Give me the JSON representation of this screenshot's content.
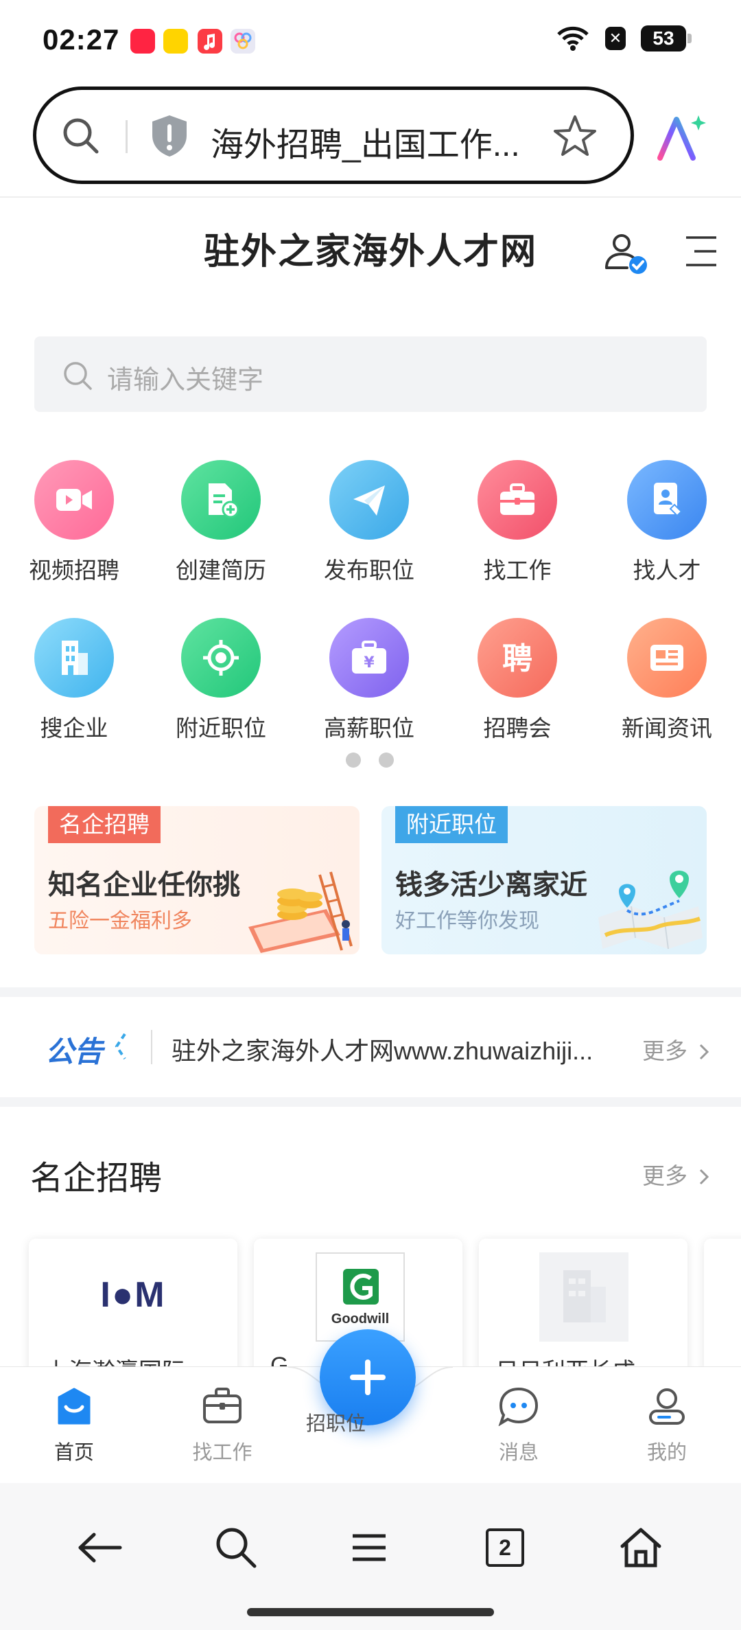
{
  "status_bar": {
    "time": "02:27",
    "battery": "53",
    "notif_apps": [
      {
        "name": "xiaohongshu-app-icon",
        "color": "#ff2442"
      },
      {
        "name": "yellow-app-icon",
        "color": "#ffd400"
      },
      {
        "name": "music-app-icon",
        "color": "#fc3c44"
      },
      {
        "name": "colorful-app-icon",
        "color": "#e8e8f4"
      }
    ]
  },
  "browser": {
    "url_title": "海外招聘_出国工作...",
    "tab_count": "2"
  },
  "site": {
    "title": "驻外之家海外人才网",
    "search_placeholder": "请输入关键字"
  },
  "grid": [
    {
      "label": "视频招聘",
      "icon": "video-icon",
      "color": "#ff7ea3"
    },
    {
      "label": "创建简历",
      "icon": "resume-add-icon",
      "color": "#3dd68c"
    },
    {
      "label": "发布职位",
      "icon": "paper-plane-icon",
      "color": "#4cb8f0"
    },
    {
      "label": "找工作",
      "icon": "briefcase-icon",
      "color": "#ff6b7d"
    },
    {
      "label": "找人才",
      "icon": "person-card-icon",
      "color": "#4d9cf6"
    },
    {
      "label": "搜企业",
      "icon": "building-icon",
      "color": "#5cc6f5"
    },
    {
      "label": "附近职位",
      "icon": "location-target-icon",
      "color": "#3dd68c"
    },
    {
      "label": "高薪职位",
      "icon": "money-box-icon",
      "color": "#9b7ff5"
    },
    {
      "label": "招聘会",
      "icon": "pin-character-icon",
      "color": "#ff7a6e"
    },
    {
      "label": "新闻资讯",
      "icon": "news-icon",
      "color": "#ff9870"
    }
  ],
  "promos": [
    {
      "tag": "名企招聘",
      "headline": "知名企业任你挑",
      "sub": "五险一金福利多",
      "tag_color": "#f26b5b",
      "sub_color": "#f0855e",
      "bg": "#fff4ee"
    },
    {
      "tag": "附近职位",
      "headline": "钱多活少离家近",
      "sub": "好工作等你发现",
      "tag_color": "#3fa6e8",
      "sub_color": "#8aa0b8",
      "bg": "#e6f5fc"
    }
  ],
  "notice": {
    "logo": "公告",
    "text": "驻外之家海外人才网www.zhuwaizhiji...",
    "more": "更多"
  },
  "famous": {
    "title": "名企招聘",
    "more": "更多",
    "companies": [
      {
        "logo": "I●M",
        "name": "上海瀚瀛国际"
      },
      {
        "logo": "Goodwill",
        "name": "G"
      },
      {
        "logo": "",
        "name": "日日利亚长成"
      }
    ]
  },
  "tabbar": {
    "tabs": [
      {
        "label": "首页",
        "icon": "home-tab-icon",
        "active": true
      },
      {
        "label": "找工作",
        "icon": "briefcase-tab-icon",
        "active": false
      },
      {
        "label": "消息",
        "icon": "chat-tab-icon",
        "active": false
      },
      {
        "label": "我的",
        "icon": "profile-tab-icon",
        "active": false
      }
    ],
    "fab_label": "招职位"
  }
}
